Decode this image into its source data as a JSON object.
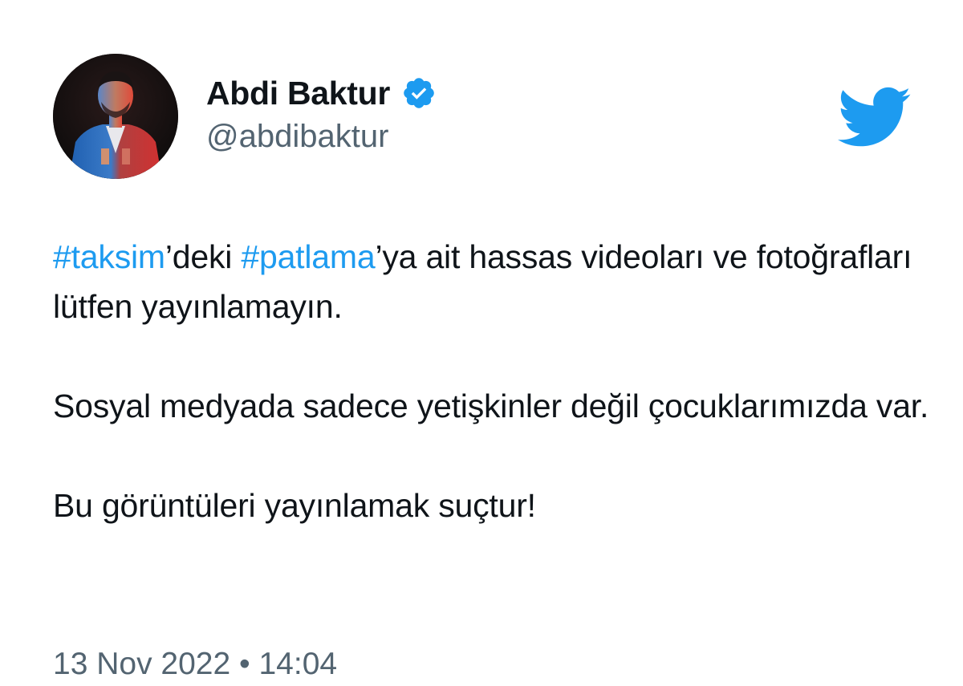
{
  "colors": {
    "accent": "#1d9bf0",
    "text_primary": "#0f1419",
    "text_secondary": "#536471",
    "background": "#ffffff"
  },
  "author": {
    "display_name": "Abdi Baktur",
    "handle": "@abdibaktur",
    "verified": true,
    "verified_icon": "verified-badge-icon",
    "avatar": "profile-photo"
  },
  "brand_icon": "twitter-bird-icon",
  "tweet": {
    "hashtag_1": "#taksim",
    "text_1": "’deki ",
    "hashtag_2": "#patlama",
    "text_2": "’ya ait hassas videoları ve fotoğrafları lütfen yayınlamayın.",
    "paragraph_2": "Sosyal medyada sadece yetişkinler değil çocuklarımızda var.",
    "paragraph_3": "Bu görüntüleri yayınlamak suçtur!"
  },
  "timestamp": "13 Nov 2022 • 14:04"
}
